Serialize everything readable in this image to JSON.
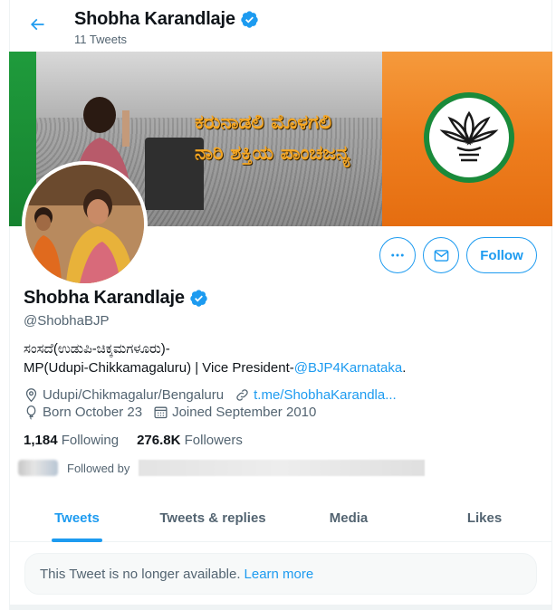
{
  "header": {
    "title": "Shobha Karandlaje",
    "tweet_count": "11 Tweets"
  },
  "banner": {
    "text_line1": "ಕರುನಾಡಲಿ ಮೊಳಗಲಿ",
    "text_line2": "ನಾರಿ ಶಕ್ತಿಯ ಪಾಂಚಜನ್ಯ"
  },
  "actions": {
    "follow_label": "Follow"
  },
  "profile": {
    "name": "Shobha Karandlaje",
    "handle": "@ShobhaBJP",
    "bio_line1": "ಸಂಸದೆ(ಉಡುಪಿ-ಚಿಕ್ಕಮಗಳೂರು)-",
    "bio_line2_prefix": "MP(Udupi-Chikkamagaluru) | Vice President-",
    "bio_mention": "@BJP4Karnataka",
    "bio_line2_suffix": ".",
    "location": "Udupi/Chikmagalur/Bengaluru",
    "link": "t.me/ShobhaKarandla...",
    "born": "Born October 23",
    "joined": "Joined September 2010"
  },
  "stats": {
    "following_count": "1,184",
    "following_label": "Following",
    "followers_count": "276.8K",
    "followers_label": "Followers"
  },
  "followed_by": {
    "label": "Followed by"
  },
  "tabs": [
    {
      "label": "Tweets",
      "active": true
    },
    {
      "label": "Tweets & replies",
      "active": false
    },
    {
      "label": "Media",
      "active": false
    },
    {
      "label": "Likes",
      "active": false
    }
  ],
  "timeline": {
    "unavailable_text": "This Tweet is no longer available.",
    "learn_more": "Learn more"
  },
  "colors": {
    "accent": "#1d9bf0",
    "text_primary": "#0f1419",
    "text_secondary": "#536471"
  }
}
